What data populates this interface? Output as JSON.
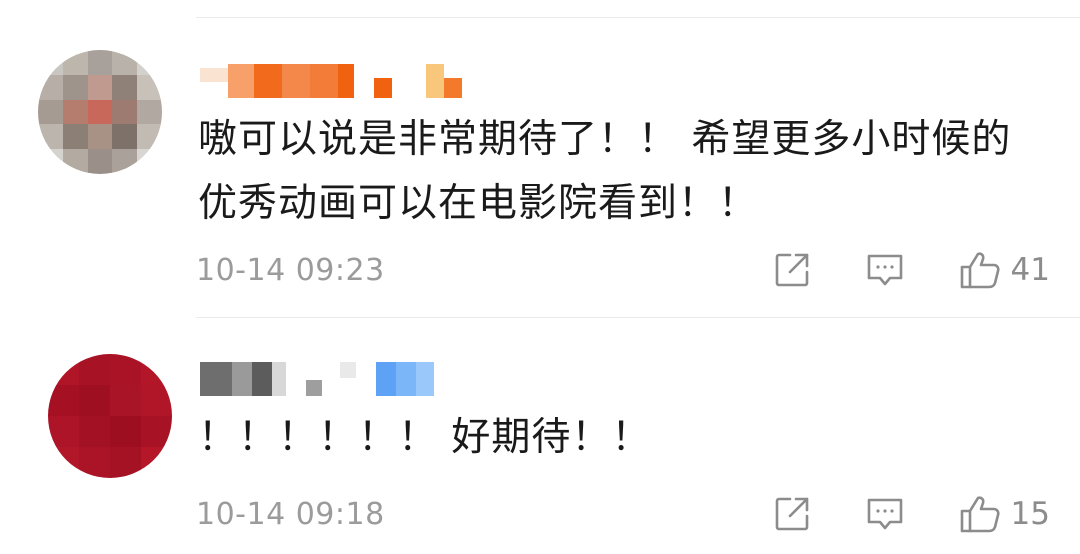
{
  "comments": [
    {
      "text_line1": "嗷可以说是非常期待了！！ 希望更多小时候的",
      "text_line2": "优秀动画可以在电影院看到！！",
      "timestamp": "10-14 09:23",
      "likes": "41"
    },
    {
      "text_line1": "！！！！！！ 好期待！！",
      "timestamp": "10-14 09:18",
      "likes": "15"
    }
  ],
  "icons": {
    "share": "share-icon",
    "comment": "comment-icon",
    "like": "thumbs-up-icon"
  },
  "colors": {
    "text": "#1a1a1a",
    "meta": "#9b9b9b",
    "icon": "#8c8c8c"
  }
}
